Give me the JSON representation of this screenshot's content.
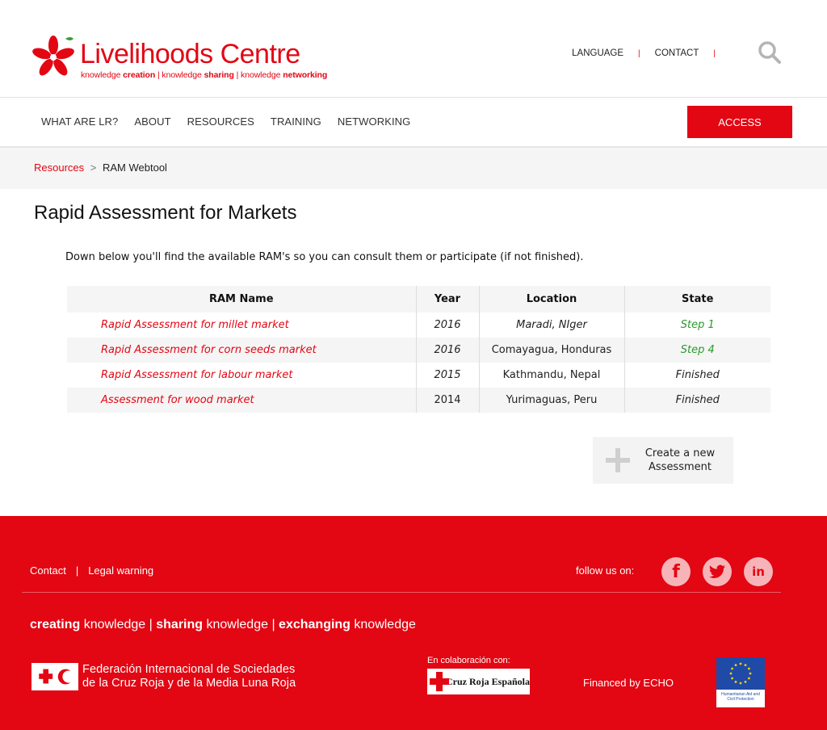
{
  "colors": {
    "brand_red": "#e30613",
    "step_green": "#2a9a2a",
    "footer_bg": "#e30613"
  },
  "header": {
    "logo": {
      "title_bold": "Live",
      "title_light": "lihoods Centre",
      "tag_1": "knowledge ",
      "tag_1b": "creation",
      "tag_2": " | knowledge ",
      "tag_2b": "sharing",
      "tag_3": " | knowledge ",
      "tag_3b": "networking"
    },
    "links": {
      "language": "LANGUAGE",
      "contact": "CONTACT",
      "separator": "|"
    },
    "search_icon": "search-icon"
  },
  "nav": {
    "items": [
      "WHAT ARE LR?",
      "ABOUT",
      "RESOURCES",
      "TRAINING",
      "NETWORKING"
    ],
    "access_label": "ACCESS"
  },
  "breadcrumb": {
    "parent": "Resources",
    "separator": ">",
    "current": "RAM Webtool"
  },
  "main": {
    "title": "Rapid Assessment for Markets",
    "intro": "Down below you'll find the available RAM's so you can consult them or participate (if not finished).",
    "table": {
      "headers": [
        "RAM Name",
        "Year",
        "Location",
        "State"
      ],
      "rows": [
        {
          "name": "Rapid Assessment for millet market",
          "year": "2016",
          "location": "Maradi, NIger",
          "state": "Step 1"
        },
        {
          "name": "Rapid Assessment for corn seeds market",
          "year": "2016",
          "location": "Comayagua, Honduras",
          "state": "Step 4"
        },
        {
          "name": "Rapid Assessment for labour market",
          "year": "2015",
          "location": "Kathmandu, Nepal",
          "state": "Finished"
        },
        {
          "name": "Assessment for wood market",
          "year": "2014",
          "location": "Yurimaguas, Peru",
          "state": "Finished"
        }
      ]
    },
    "create_button": {
      "line1": "Create a new",
      "line2": "Assessment",
      "icon": "plus-icon"
    }
  },
  "footer": {
    "links": {
      "contact": "Contact",
      "separator": "|",
      "legal": "Legal warning"
    },
    "follow": "follow us on:",
    "social": {
      "facebook": "f",
      "twitter": "twitter-icon",
      "linkedin": "in"
    },
    "tagline": {
      "w1": "creating",
      "t1": " knowledge | ",
      "w2": "sharing",
      "t2": " knowledge | ",
      "w3": "exchanging",
      "t3": " knowledge"
    },
    "ifrc": {
      "line1": "Federación Internacional de Sociedades",
      "line2": "de la Cruz Roja y de la Media Luna Roja"
    },
    "collab_label": "En colaboración con:",
    "cruz_roja": "Cruz Roja Española",
    "financed": "Financed by ECHO",
    "echo_text": "Humanitarian Aid and Civil Protection"
  }
}
